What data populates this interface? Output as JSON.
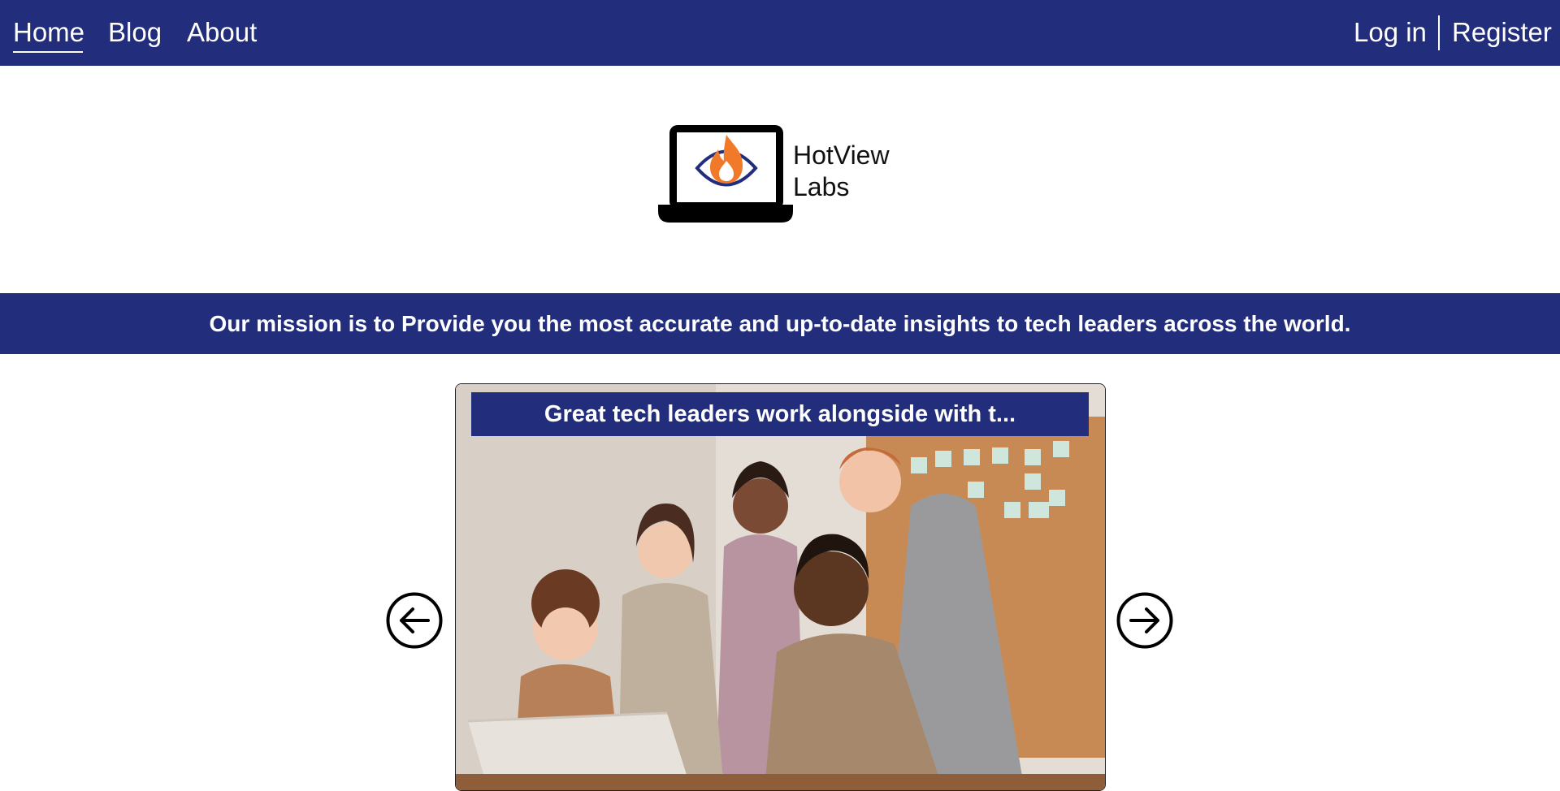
{
  "nav": {
    "home": "Home",
    "blog": "Blog",
    "about": "About",
    "login": "Log in",
    "register": "Register"
  },
  "logo": {
    "line1": "HotView",
    "line2": "Labs",
    "icon": "laptop-eye-flame-icon"
  },
  "mission": "Our mission is to Provide you the most accurate and up-to-date insights to tech leaders across the world.",
  "carousel": {
    "slide_title": "Great tech leaders work alongside with t...",
    "prev_icon": "arrow-left-circle-icon",
    "next_icon": "arrow-right-circle-icon"
  },
  "colors": {
    "brand_navy": "#222d7c",
    "flame_orange": "#f07a2a",
    "white": "#ffffff"
  }
}
